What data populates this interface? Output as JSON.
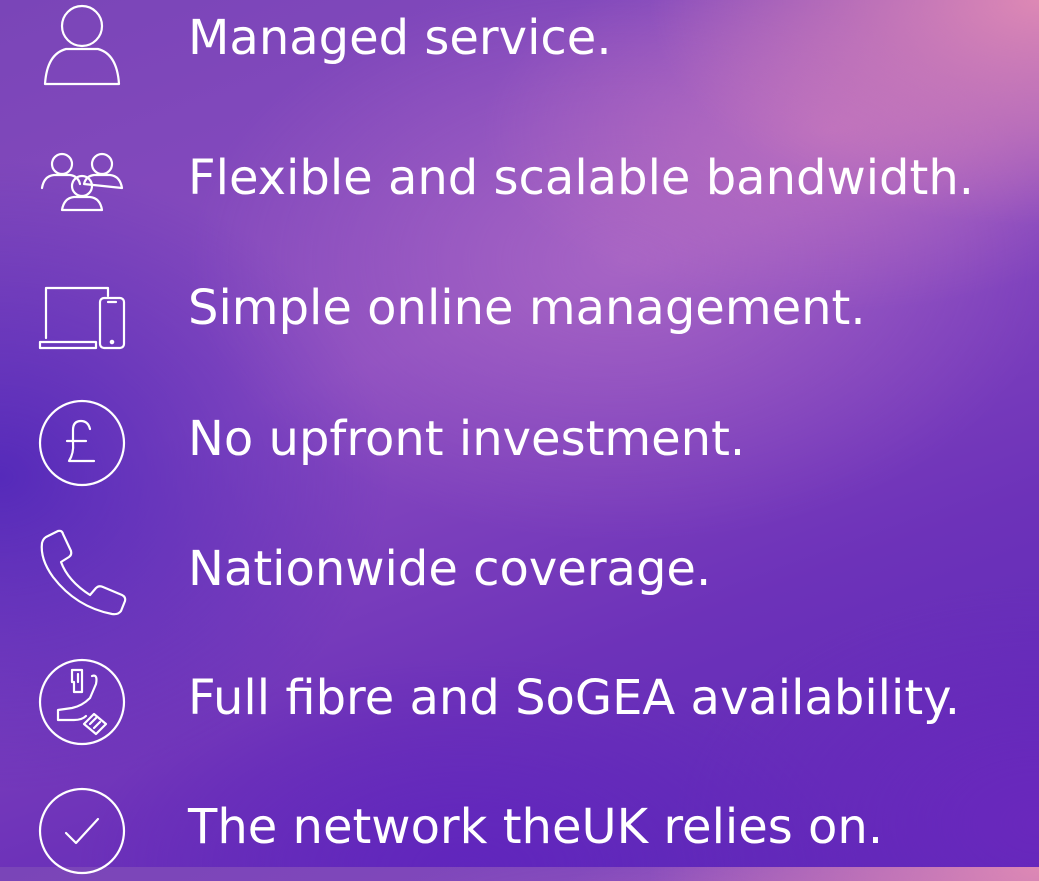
{
  "features": [
    {
      "icon": "person-icon",
      "text": "Managed service."
    },
    {
      "icon": "people-group-icon",
      "text": "Flexible and scalable bandwidth."
    },
    {
      "icon": "laptop-phone-icon",
      "text": "Simple online management."
    },
    {
      "icon": "pound-coin-icon",
      "text": "No upfront investment."
    },
    {
      "icon": "phone-handset-icon",
      "text": "Nationwide coverage."
    },
    {
      "icon": "fibre-socket-icon",
      "text": "Full fibre and SoGEA availability."
    },
    {
      "icon": "check-circle-icon",
      "text": "The network theUK relies on."
    }
  ],
  "colors": {
    "text": "#ffffff",
    "icon_stroke": "#ffffff",
    "gradient_top_right": "#e28cb4",
    "gradient_left": "#4c24b9",
    "gradient_bottom": "#5a26b8"
  }
}
